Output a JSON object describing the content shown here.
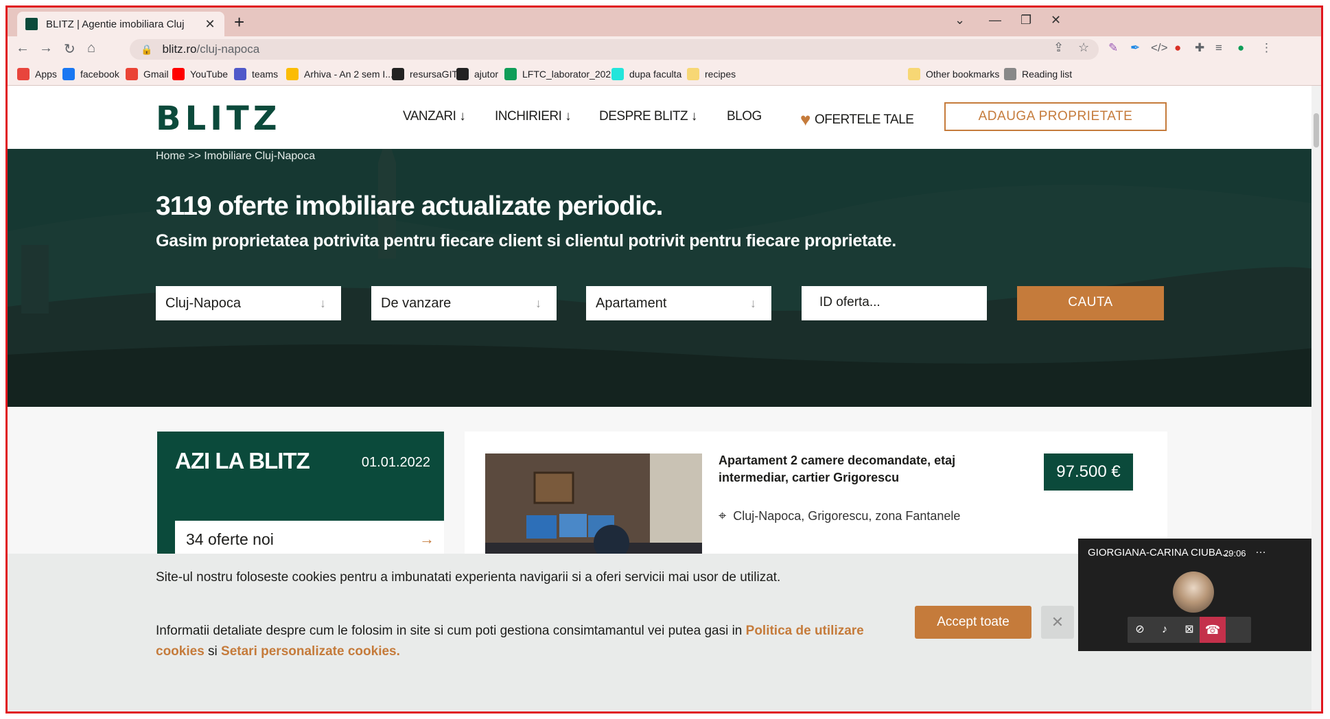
{
  "browser": {
    "tab_title": "BLITZ | Agentie imobiliara Cluj",
    "url_domain": "blitz.ro",
    "url_path": "/cluj-napoca",
    "bookmarks": [
      {
        "label": "Apps",
        "icon": "apps-grid-icon",
        "color": "#e8453c"
      },
      {
        "label": "facebook",
        "icon": "facebook-icon",
        "color": "#1877f2"
      },
      {
        "label": "Gmail",
        "icon": "gmail-icon",
        "color": "#ea4335"
      },
      {
        "label": "YouTube",
        "icon": "youtube-icon",
        "color": "#ff0000"
      },
      {
        "label": "teams",
        "icon": "teams-icon",
        "color": "#5059c9"
      },
      {
        "label": "Arhiva - An 2 sem I...",
        "icon": "drive-icon",
        "color": "#fbbc04"
      },
      {
        "label": "resursaGIT",
        "icon": "github-icon",
        "color": "#222222"
      },
      {
        "label": "ajutor",
        "icon": "github-icon",
        "color": "#222222"
      },
      {
        "label": "LFTC_laborator_202...",
        "icon": "sheets-icon",
        "color": "#0f9d58"
      },
      {
        "label": "dupa faculta",
        "icon": "olx-icon",
        "color": "#23e5db"
      },
      {
        "label": "recipes",
        "icon": "folder-icon",
        "color": "#f7d774"
      }
    ],
    "other_bookmarks": "Other bookmarks",
    "reading_list": "Reading list"
  },
  "site": {
    "logo": "BLITZ",
    "menu": [
      "VANZARI ↓",
      "INCHIRIERI ↓",
      "DESPRE BLITZ ↓",
      "BLOG"
    ],
    "offers": "OFERTELE TALE",
    "add_property": "ADAUGA PROPRIETATE",
    "breadcrumb": "Home >> Imobiliare Cluj-Napoca",
    "headline": "3119 oferte imobiliare actualizate periodic.",
    "subheadline": "Gasim proprietatea potrivita pentru fiecare client si clientul potrivit pentru fiecare proprietate.",
    "search": {
      "city": "Cluj-Napoca",
      "type": "De vanzare",
      "property": "Apartament",
      "id_placeholder": "ID oferta...",
      "button": "CAUTA"
    },
    "today": {
      "title": "AZI LA BLITZ",
      "date": "01.01.2022",
      "new_offers": "34 oferte noi"
    },
    "listing": {
      "title": "Apartament 2 camere decomandate, etaj intermediar, cartier Grigorescu",
      "price": "97.500 €",
      "location": "Cluj-Napoca, Grigorescu, zona Fantanele"
    },
    "cookies": {
      "text1": "Site-ul nostru foloseste cookies pentru a imbunatati experienta navigarii si a oferi servicii mai usor de utilizat.",
      "text2_pre": "Informatii detaliate despre cum le folosim in site si cum poti gestiona consimtamantul vei putea gasi in ",
      "link1": "Politica de utilizare cookies",
      "text2_mid": " si ",
      "link2": "Setari personalizate cookies.",
      "accept": "Accept toate"
    }
  },
  "call": {
    "name": "GIORGIANA-CARINA CIUBA...",
    "time": "29:06"
  },
  "colors": {
    "brand_green": "#0b4a3b",
    "brand_orange": "#c57b3b"
  }
}
